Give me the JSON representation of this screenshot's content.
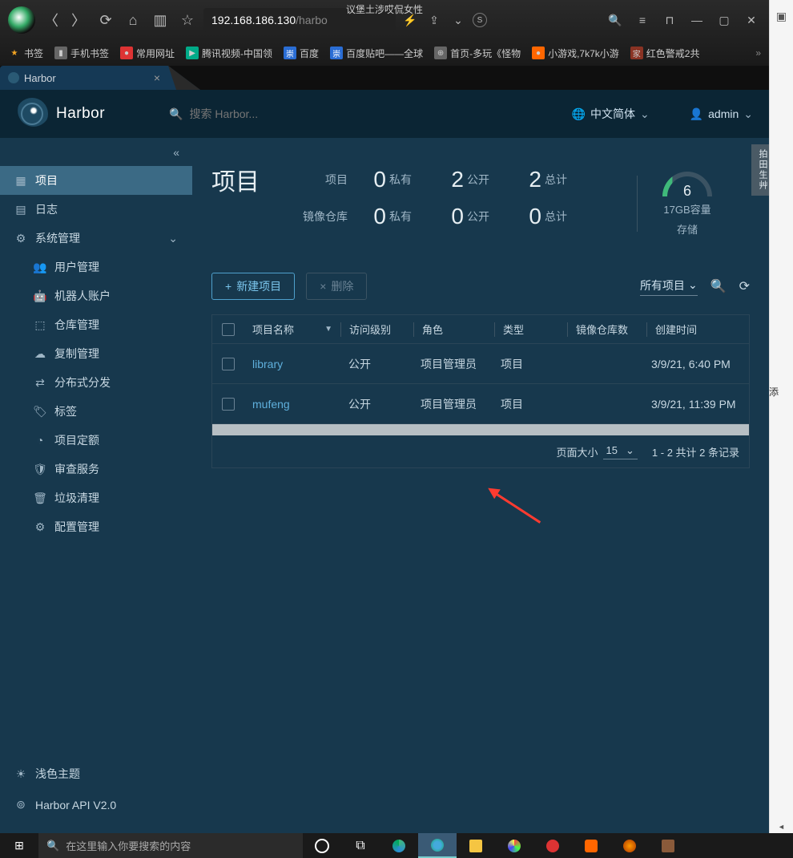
{
  "browser": {
    "title_overlay": "议堡土涉哎侃女性",
    "url_host": "192.168.186.130",
    "url_path": "/harbo",
    "bookmarks": [
      {
        "label": "书签",
        "ico": "★",
        "cls": "bm-star"
      },
      {
        "label": "手机书签",
        "ico": "▮",
        "cls": "bm-gray"
      },
      {
        "label": "常用网址",
        "ico": "●",
        "cls": "bm-red"
      },
      {
        "label": "腾讯视频-中国领",
        "ico": "▶",
        "cls": "bm-green"
      },
      {
        "label": "百度",
        "ico": "崇",
        "cls": "bm-blue"
      },
      {
        "label": "百度贴吧——全球",
        "ico": "崇",
        "cls": "bm-blue"
      },
      {
        "label": "首页-多玩《怪物",
        "ico": "⊕",
        "cls": "bm-gray"
      },
      {
        "label": "小游戏,7k7k小游",
        "ico": "●",
        "cls": "bm-orange"
      },
      {
        "label": "红色警戒2共",
        "ico": "家",
        "cls": "bm-brown"
      }
    ],
    "tab_title": "Harbor"
  },
  "harbor": {
    "brand": "Harbor",
    "search_placeholder": "搜索 Harbor...",
    "lang": "中文简体",
    "user": "admin"
  },
  "sidebar": {
    "projects": "项目",
    "logs": "日志",
    "admin": "系统管理",
    "subs": {
      "users": "用户管理",
      "robots": "机器人账户",
      "registries": "仓库管理",
      "replications": "复制管理",
      "distribution": "分布式分发",
      "labels": "标签",
      "quotas": "项目定额",
      "interrogation": "审查服务",
      "gc": "垃圾清理",
      "config": "配置管理"
    },
    "theme": "浅色主题",
    "api": "Harbor API V2.0"
  },
  "page": {
    "title": "项目",
    "labels": {
      "project": "项目",
      "repo": "镜像仓库",
      "private": "私有",
      "public": "公开",
      "total": "总计"
    },
    "stats": {
      "proj_private": "0",
      "proj_public": "2",
      "proj_total": "2",
      "repo_private": "0",
      "repo_public": "0",
      "repo_total": "0"
    },
    "gauge": {
      "value": "6",
      "sub1": "17GB容量",
      "sub2": "存储"
    }
  },
  "toolbar": {
    "new_btn": "新建项目",
    "del_btn": "删除",
    "filter": "所有项目"
  },
  "table": {
    "columns": {
      "name": "项目名称",
      "access": "访问级别",
      "role": "角色",
      "type": "类型",
      "repo": "镜像仓库数",
      "time": "创建时间"
    },
    "rows": [
      {
        "name": "library",
        "access": "公开",
        "role": "项目管理员",
        "type": "项目",
        "time": "3/9/21, 6:40 PM"
      },
      {
        "name": "mufeng",
        "access": "公开",
        "role": "项目管理员",
        "type": "项目",
        "time": "3/9/21, 11:39 PM"
      }
    ]
  },
  "pager": {
    "size_label": "页面大小",
    "size": "15",
    "info": "1 - 2 共计 2 条记录"
  },
  "taskbar": {
    "search_placeholder": "在这里输入你要搜索的内容"
  },
  "side_tab": "拍田生艸"
}
